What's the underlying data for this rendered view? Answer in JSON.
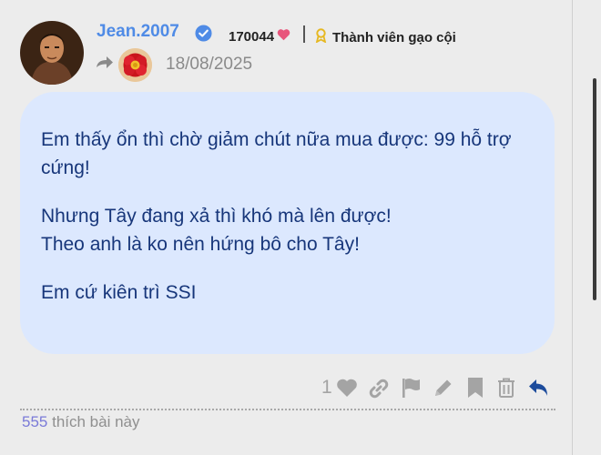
{
  "post": {
    "username": "Jean.2007",
    "score": "170044",
    "rank_title": "Thành viên gạo cội",
    "date": "18/08/2025",
    "body": [
      "Em thấy ổn thì chờ giảm chút nữa mua được: 99 hỗ trợ cứng!",
      "Nhưng Tây đang xả thì khó mà lên được!\nTheo anh là ko nên hứng bô cho Tây!",
      "Em cứ kiên trì SSI"
    ],
    "like_count": "1",
    "likes_number": "555",
    "likes_suffix": " thích bài này"
  },
  "colors": {
    "username": "#4f8be6",
    "bubble_bg": "#dce8fe",
    "body_text": "#17367a",
    "heart": "#e8567c",
    "action_icons": "#a4a4a4",
    "reply_icon": "#1d4c9c"
  },
  "icons": [
    "verified-badge-icon",
    "heart-icon",
    "ribbon-icon",
    "share-arrow-icon",
    "link-icon",
    "flag-icon",
    "pencil-icon",
    "bookmark-icon",
    "trash-icon",
    "reply-icon"
  ]
}
